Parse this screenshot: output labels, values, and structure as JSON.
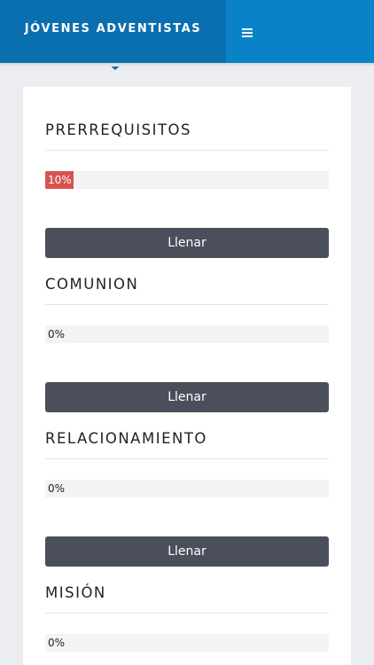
{
  "header": {
    "brand": "JÓVENES ADVENTISTAS",
    "menu_icon": "hamburger-icon",
    "brand_color": "#0a6fae",
    "bar_color": "#0a82c8"
  },
  "sections": [
    {
      "title": "PRERREQUISITOS",
      "progress_label": "10%",
      "progress": 0.1,
      "button_label": "Llenar"
    },
    {
      "title": "COMUNION",
      "progress_label": "0%",
      "progress": 0,
      "button_label": "Llenar"
    },
    {
      "title": "RELACIONAMIENTO",
      "progress_label": "0%",
      "progress": 0,
      "button_label": "Llenar"
    },
    {
      "title": "MISIÓN",
      "progress_label": "0%",
      "progress": 0
    }
  ],
  "colors": {
    "progress_fill": "#d9534f",
    "button": "#4a4f5b"
  }
}
